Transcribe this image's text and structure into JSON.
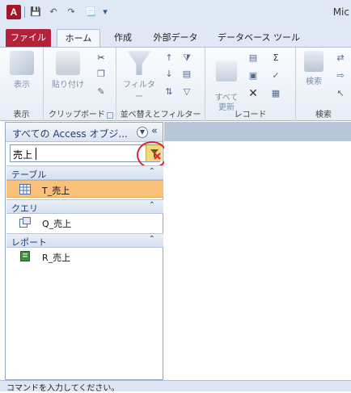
{
  "title_bar": {
    "app_letter": "A",
    "window_title": "Mic"
  },
  "tabs": {
    "file": "ファイル",
    "home": "ホーム",
    "create": "作成",
    "external": "外部データ",
    "db_tools": "データベース ツール"
  },
  "ribbon": {
    "view": {
      "button": "表示",
      "group": "表示"
    },
    "clipboard": {
      "paste": "貼り付け",
      "group": "クリップボード"
    },
    "sort_filter": {
      "filter": "フィルター",
      "group": "並べ替えとフィルター"
    },
    "records": {
      "refresh": "すべて\n更新",
      "group": "レコード"
    },
    "find": {
      "find": "検索",
      "group": "検索"
    }
  },
  "nav": {
    "title": "すべての Access オブジ...",
    "search_value": "売上",
    "sections": [
      {
        "label": "テーブル",
        "items": [
          {
            "label": "T_売上",
            "selected": true
          }
        ]
      },
      {
        "label": "クエリ",
        "items": [
          {
            "label": "Q_売上",
            "selected": false
          }
        ]
      },
      {
        "label": "レポート",
        "items": [
          {
            "label": "R_売上",
            "selected": false
          }
        ]
      }
    ]
  },
  "status": {
    "text": "コマンドを入力してください。"
  },
  "colors": {
    "accent_file_tab": "#b3213a",
    "selected_item": "#f9c07a",
    "highlight_circle": "#d8262e"
  },
  "icons": [
    "access-app-icon",
    "save-icon",
    "undo-icon",
    "redo-icon",
    "customize-icon",
    "view-icon",
    "paste-icon",
    "cut-icon",
    "copy-icon",
    "format-painter-icon",
    "filter-icon",
    "sort-asc-icon",
    "sort-desc-icon",
    "refresh-icon",
    "sum-icon",
    "spelling-icon",
    "delete-icon",
    "find-icon",
    "replace-icon",
    "table-icon",
    "query-icon",
    "report-icon",
    "clear-search-icon"
  ]
}
